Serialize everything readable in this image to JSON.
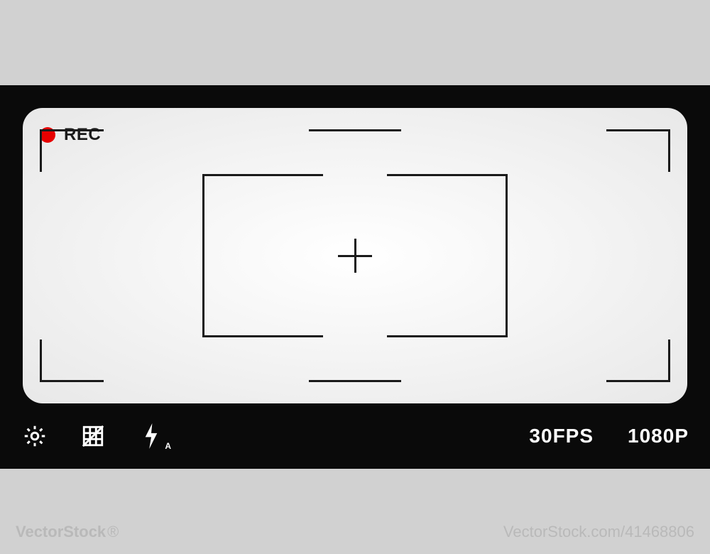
{
  "recording": {
    "label": "REC",
    "dot_color": "#e60000"
  },
  "toolbar": {
    "settings_icon": "gear",
    "grid_icon": "grid-off",
    "flash_icon": "flash",
    "flash_mode": "A"
  },
  "stats": {
    "fps": "30FPS",
    "resolution": "1080P"
  },
  "watermark": {
    "brand": "VectorStock",
    "suffix": "®",
    "id": "41468806",
    "domain": "VectorStock.com"
  }
}
